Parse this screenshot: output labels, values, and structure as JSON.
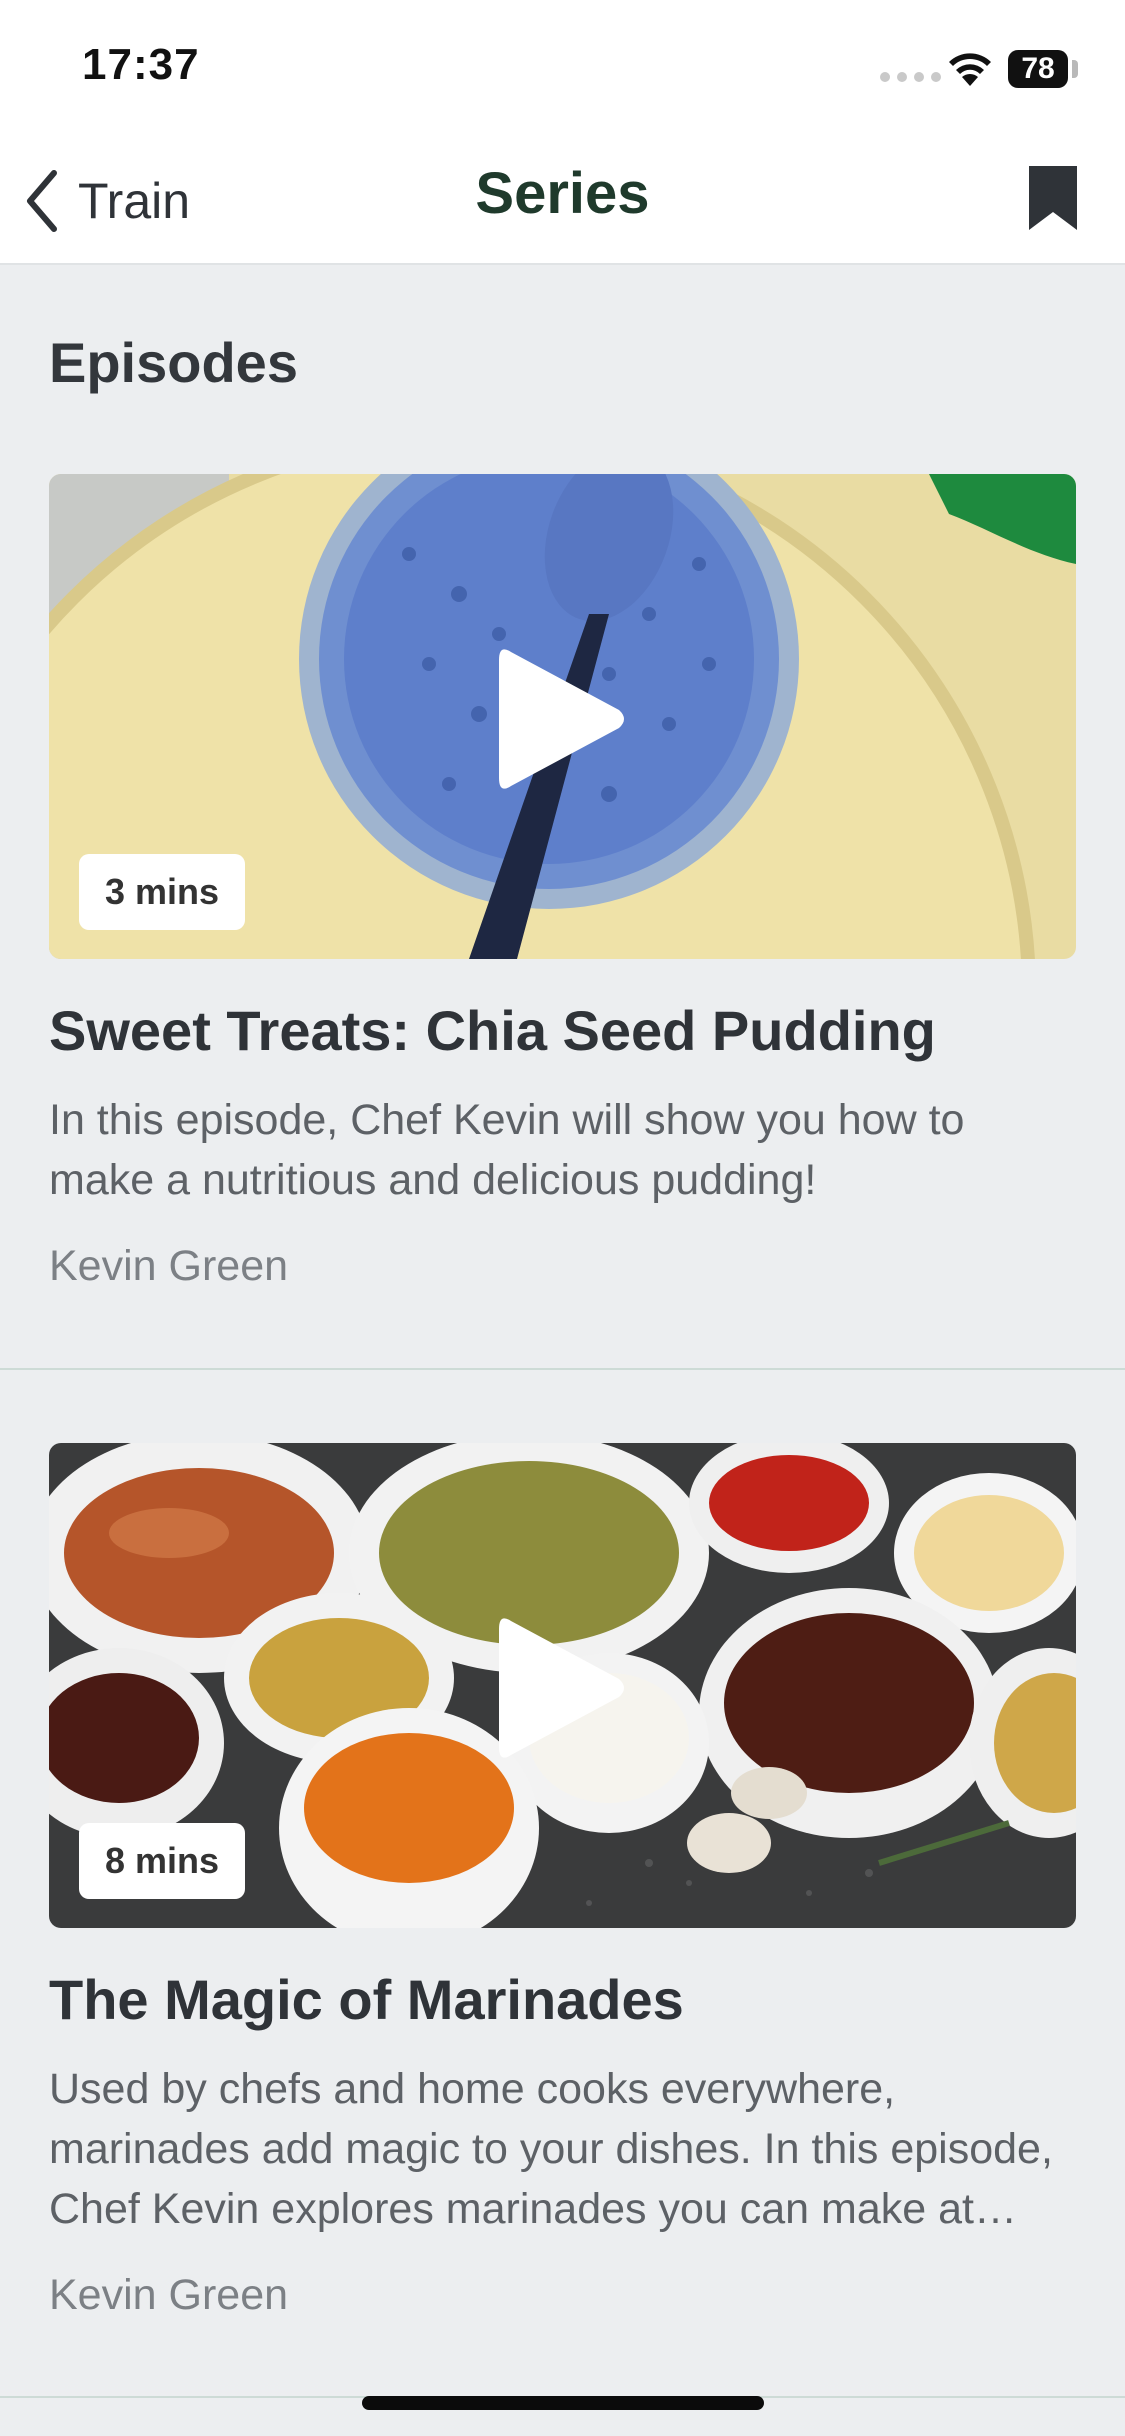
{
  "status_bar": {
    "time": "17:37",
    "battery": "78"
  },
  "nav": {
    "back_label": "Train",
    "title": "Series"
  },
  "section": {
    "title": "Episodes"
  },
  "episodes": [
    {
      "duration": "3 mins",
      "title": "Sweet Treats: Chia Seed Pudding",
      "description": "In this episode, Chef Kevin will show you how to make a nutritious and delicious pudding!",
      "author": "Kevin Green"
    },
    {
      "duration": "8 mins",
      "title": "The Magic of Marinades",
      "description": "Used by chefs and home cooks everywhere, marinades add magic to your dishes. In this episode, Chef Kevin explores marinades you can make at home.",
      "author": "Kevin Green"
    }
  ],
  "icons": {
    "back": "chevron-left-icon",
    "bookmark": "bookmark-icon",
    "play": "play-icon",
    "wifi": "wifi-icon"
  },
  "colors": {
    "title": "#1f3a2c",
    "background": "#eceef0",
    "accent_divider": "#cddbd6"
  }
}
